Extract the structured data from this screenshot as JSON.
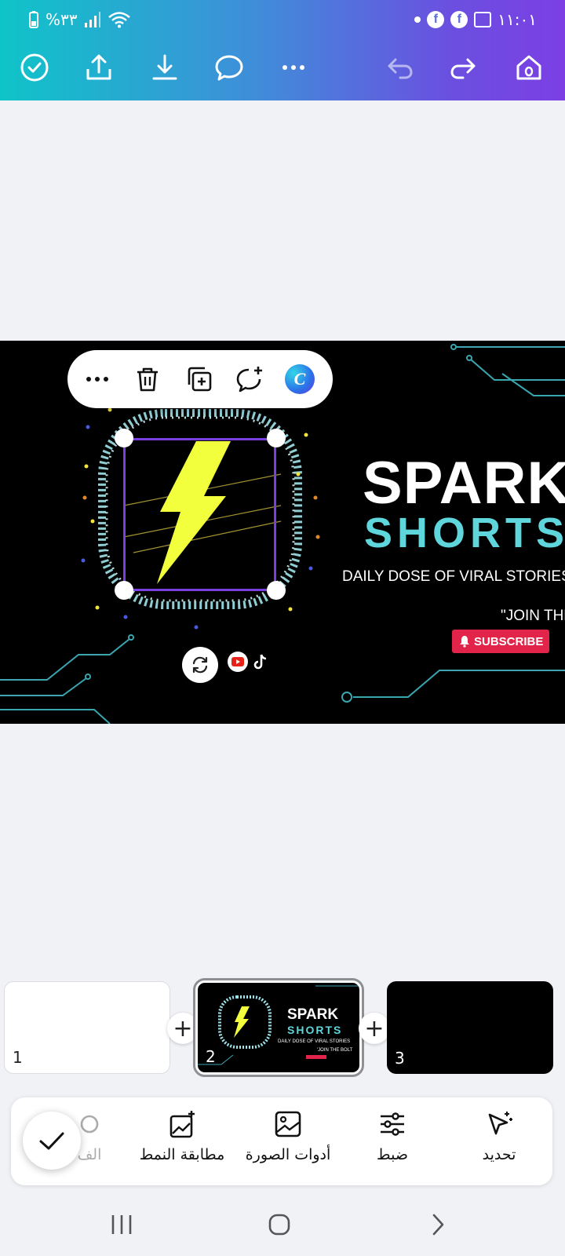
{
  "status_bar": {
    "battery": "%٣٣",
    "time": "١١:٠١",
    "fb_glyph": "f"
  },
  "toolbar": {
    "icons": [
      "check-circle-icon",
      "share-icon",
      "download-icon",
      "comment-icon",
      "more-icon",
      "undo-icon",
      "redo-icon",
      "home-icon"
    ]
  },
  "context_menu": {
    "items": [
      "more-icon",
      "delete-icon",
      "duplicate-icon",
      "add-comment-icon",
      "canva-assistant-icon"
    ],
    "canva_glyph": "C"
  },
  "design": {
    "title_line1": "SPARK",
    "title_line2": "SHORTS",
    "tagline": "DAILY DOSE OF VIRAL STORIES",
    "join_text": "\"JOIN THE",
    "subscribe_label": "SUBSCRIBE",
    "colors": {
      "background": "#000000",
      "accent": "#5fd6dc",
      "bolt": "#f2ff3c",
      "subscribe": "#e2244a",
      "selection": "#7a3fe0"
    }
  },
  "pages": {
    "thumbs": [
      {
        "num": "1"
      },
      {
        "num": "2",
        "title1": "SPARK",
        "title2": "SHORTS",
        "tagline": "DAILY DOSE OF VIRAL STORIES",
        "join": "'JOIN THE BOLT"
      },
      {
        "num": "3"
      }
    ],
    "add_label": "+"
  },
  "tools": {
    "select": "تحديد",
    "adjust": "ضبط",
    "image_tools": "أدوات الصورة",
    "style_match": "مطابقة النمط",
    "filters_partial": "الف"
  },
  "theme": {
    "gradient_start": "#0fc4c9",
    "gradient_end": "#7c3fe4"
  }
}
